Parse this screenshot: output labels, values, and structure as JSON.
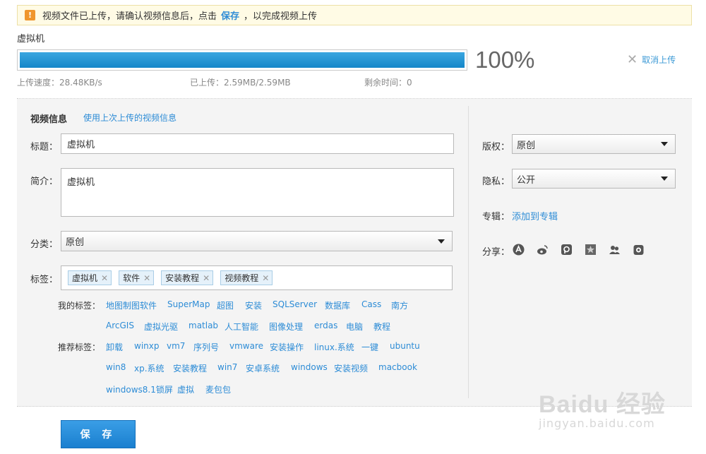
{
  "notice": {
    "part1": "视频文件已上传，请确认视频信息后，点击",
    "link": "保存",
    "part2": "，以完成视频上传"
  },
  "file": {
    "name": "虚拟机"
  },
  "progress": {
    "percent_value": 100,
    "percent_text": "100%",
    "cancel": "取消上传"
  },
  "stats": {
    "speed": "上传速度：28.48KB/s",
    "uploaded": "已上传：2.59MB/2.59MB",
    "remaining": "剩余时间：0"
  },
  "info": {
    "title": "视频信息",
    "use_last": "使用上次上传的视频信息"
  },
  "form": {
    "title_label": "标题：",
    "title_value": "虚拟机",
    "intro_label": "简介：",
    "intro_value": "虚拟机",
    "category_label": "分类：",
    "category_value": "原创",
    "tags_label": "标签：",
    "tags": [
      "虚拟机",
      "软件",
      "安装教程",
      "视频教程"
    ],
    "my_tags_label": "我的标签：",
    "my_tags_row1": [
      "地图制图软件",
      "SuperMap",
      "超图",
      "安装",
      "SQLServer",
      "数据库",
      "Cass",
      "南方"
    ],
    "my_tags_row2": [
      "ArcGIS",
      "虚拟光驱",
      "matlab",
      "人工智能",
      "图像处理",
      "erdas",
      "电脑",
      "教程"
    ],
    "rec_tags_label": "推荐标签：",
    "rec_tags_row1": [
      "卸载",
      "winxp",
      "vm7",
      "序列号",
      "vmware",
      "安装操作",
      "linux.系统",
      "一键",
      "ubuntu"
    ],
    "rec_tags_row2": [
      "win8",
      "xp.系统",
      "安装教程",
      "win7",
      "安卓系统",
      "windows",
      "安装视频",
      "macbook"
    ],
    "rec_tags_row3": [
      "windows8.1锁屏",
      "虚拟",
      "麦包包"
    ]
  },
  "side": {
    "copyright_label": "版权：",
    "copyright_value": "原创",
    "privacy_label": "隐私：",
    "privacy_value": "公开",
    "album_label": "专辑：",
    "album_link": "添加到专辑",
    "share_label": "分享：",
    "share_icons": [
      "share-site-icon",
      "weibo-icon",
      "pengyou-icon",
      "qzone-icon",
      "renren-icon",
      "kaixin-icon"
    ]
  },
  "save_button": "保 存",
  "watermark": {
    "brand": "Baidu 经验",
    "url": "jingyan.baidu.com"
  },
  "colors": {
    "accent": "#2d8cd6",
    "progress": "#1486c8",
    "warn": "#f0962d"
  }
}
